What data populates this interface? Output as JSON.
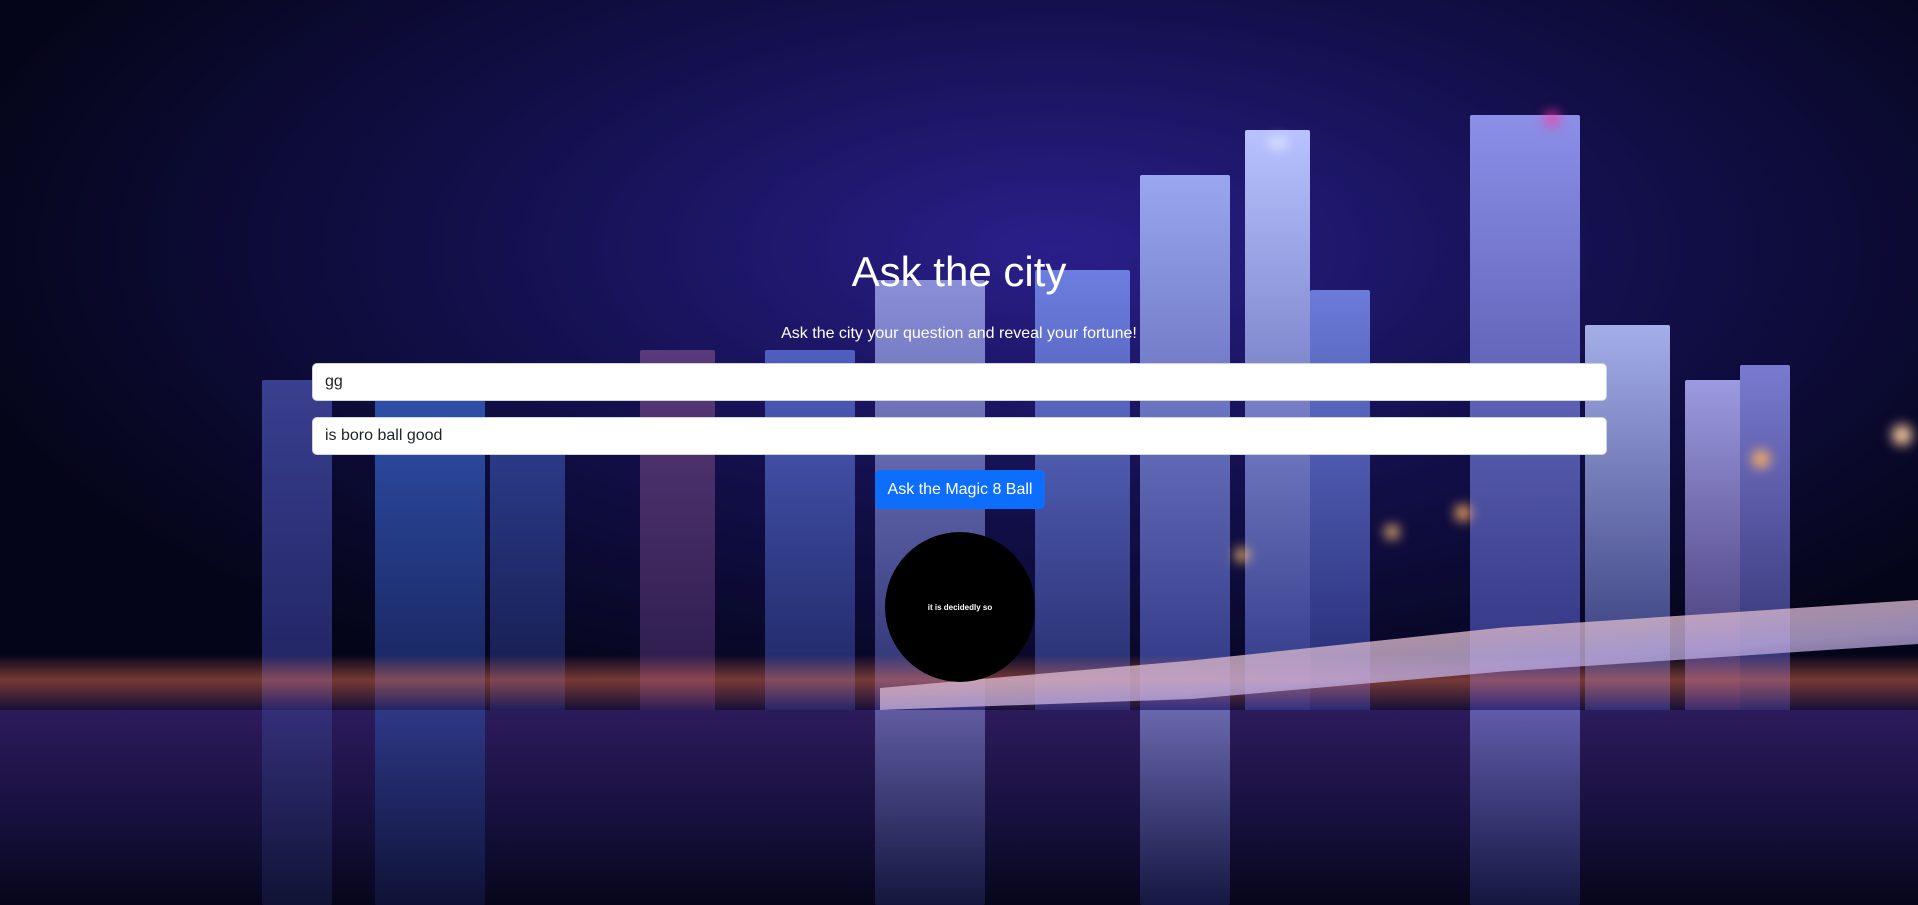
{
  "page": {
    "title": "Ask the city",
    "subtitle": "Ask the city your question and reveal your fortune!"
  },
  "form": {
    "name_value": "gg",
    "question_value": "is boro ball good",
    "ask_button_label": "Ask the Magic 8 Ball"
  },
  "magic_ball": {
    "answer": "it is decidedly so"
  },
  "colors": {
    "button": "#0d6efd",
    "ball": "#000000",
    "text": "#ffffff"
  }
}
